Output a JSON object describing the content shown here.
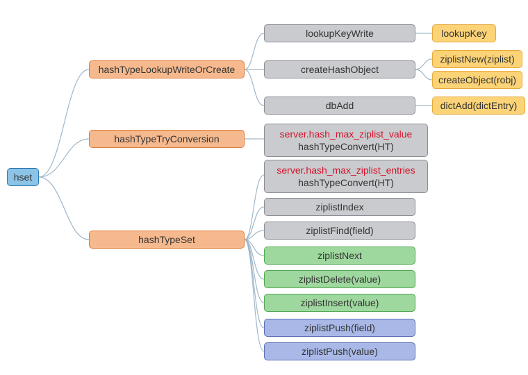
{
  "root": {
    "label": "hset"
  },
  "level2": {
    "hashTypeLookupWriteOrCreate": "hashTypeLookupWriteOrCreate",
    "hashTypeTryConversion": "hashTypeTryConversion",
    "hashTypeSet": "hashTypeSet"
  },
  "lookup_children": {
    "lookupKeyWrite": "lookupKeyWrite",
    "createHashObject": "createHashObject",
    "dbAdd": "dbAdd"
  },
  "lookup_leaves": {
    "lookupKey": "lookupKey",
    "ziplistNew": "ziplistNew(ziplist)",
    "createObject": "createObject(robj)",
    "dictAdd": "dictAdd(dictEntry)"
  },
  "tryconv": {
    "cond": "server.hash_max_ziplist_value",
    "action": "hashTypeConvert(HT)"
  },
  "set_children": {
    "cond_box": {
      "cond": "server.hash_max_ziplist_entries",
      "action": "hashTypeConvert(HT)"
    },
    "ziplistIndex": "ziplistIndex",
    "ziplistFind": "ziplistFind(field)",
    "ziplistNext": "ziplistNext",
    "ziplistDelete": "ziplistDelete(value)",
    "ziplistInsert": "ziplistInsert(value)",
    "ziplistPushField": "ziplistPush(field)",
    "ziplistPushValue": "ziplistPush(value)"
  }
}
